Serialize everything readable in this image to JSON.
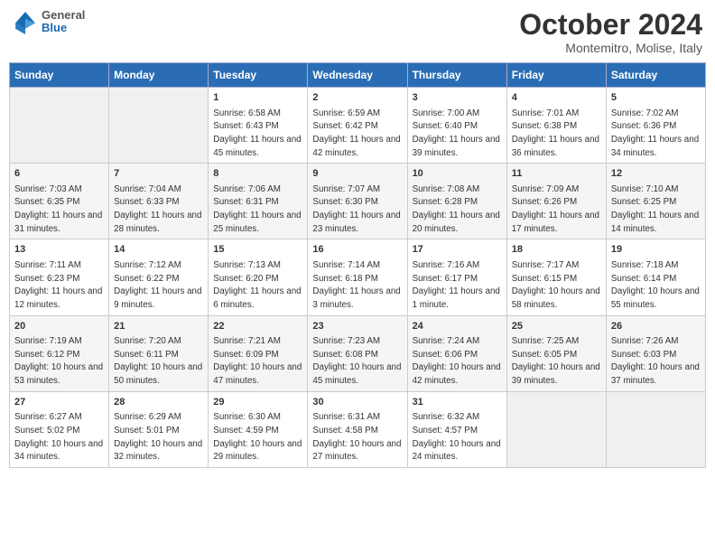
{
  "header": {
    "logo": {
      "line1": "General",
      "line2": "Blue"
    },
    "title": "October 2024",
    "location": "Montemitro, Molise, Italy"
  },
  "weekdays": [
    "Sunday",
    "Monday",
    "Tuesday",
    "Wednesday",
    "Thursday",
    "Friday",
    "Saturday"
  ],
  "weeks": [
    [
      {
        "day": "",
        "sunrise": "",
        "sunset": "",
        "daylight": "",
        "empty": true
      },
      {
        "day": "",
        "sunrise": "",
        "sunset": "",
        "daylight": "",
        "empty": true
      },
      {
        "day": "1",
        "sunrise": "Sunrise: 6:58 AM",
        "sunset": "Sunset: 6:43 PM",
        "daylight": "Daylight: 11 hours and 45 minutes."
      },
      {
        "day": "2",
        "sunrise": "Sunrise: 6:59 AM",
        "sunset": "Sunset: 6:42 PM",
        "daylight": "Daylight: 11 hours and 42 minutes."
      },
      {
        "day": "3",
        "sunrise": "Sunrise: 7:00 AM",
        "sunset": "Sunset: 6:40 PM",
        "daylight": "Daylight: 11 hours and 39 minutes."
      },
      {
        "day": "4",
        "sunrise": "Sunrise: 7:01 AM",
        "sunset": "Sunset: 6:38 PM",
        "daylight": "Daylight: 11 hours and 36 minutes."
      },
      {
        "day": "5",
        "sunrise": "Sunrise: 7:02 AM",
        "sunset": "Sunset: 6:36 PM",
        "daylight": "Daylight: 11 hours and 34 minutes."
      }
    ],
    [
      {
        "day": "6",
        "sunrise": "Sunrise: 7:03 AM",
        "sunset": "Sunset: 6:35 PM",
        "daylight": "Daylight: 11 hours and 31 minutes."
      },
      {
        "day": "7",
        "sunrise": "Sunrise: 7:04 AM",
        "sunset": "Sunset: 6:33 PM",
        "daylight": "Daylight: 11 hours and 28 minutes."
      },
      {
        "day": "8",
        "sunrise": "Sunrise: 7:06 AM",
        "sunset": "Sunset: 6:31 PM",
        "daylight": "Daylight: 11 hours and 25 minutes."
      },
      {
        "day": "9",
        "sunrise": "Sunrise: 7:07 AM",
        "sunset": "Sunset: 6:30 PM",
        "daylight": "Daylight: 11 hours and 23 minutes."
      },
      {
        "day": "10",
        "sunrise": "Sunrise: 7:08 AM",
        "sunset": "Sunset: 6:28 PM",
        "daylight": "Daylight: 11 hours and 20 minutes."
      },
      {
        "day": "11",
        "sunrise": "Sunrise: 7:09 AM",
        "sunset": "Sunset: 6:26 PM",
        "daylight": "Daylight: 11 hours and 17 minutes."
      },
      {
        "day": "12",
        "sunrise": "Sunrise: 7:10 AM",
        "sunset": "Sunset: 6:25 PM",
        "daylight": "Daylight: 11 hours and 14 minutes."
      }
    ],
    [
      {
        "day": "13",
        "sunrise": "Sunrise: 7:11 AM",
        "sunset": "Sunset: 6:23 PM",
        "daylight": "Daylight: 11 hours and 12 minutes."
      },
      {
        "day": "14",
        "sunrise": "Sunrise: 7:12 AM",
        "sunset": "Sunset: 6:22 PM",
        "daylight": "Daylight: 11 hours and 9 minutes."
      },
      {
        "day": "15",
        "sunrise": "Sunrise: 7:13 AM",
        "sunset": "Sunset: 6:20 PM",
        "daylight": "Daylight: 11 hours and 6 minutes."
      },
      {
        "day": "16",
        "sunrise": "Sunrise: 7:14 AM",
        "sunset": "Sunset: 6:18 PM",
        "daylight": "Daylight: 11 hours and 3 minutes."
      },
      {
        "day": "17",
        "sunrise": "Sunrise: 7:16 AM",
        "sunset": "Sunset: 6:17 PM",
        "daylight": "Daylight: 11 hours and 1 minute."
      },
      {
        "day": "18",
        "sunrise": "Sunrise: 7:17 AM",
        "sunset": "Sunset: 6:15 PM",
        "daylight": "Daylight: 10 hours and 58 minutes."
      },
      {
        "day": "19",
        "sunrise": "Sunrise: 7:18 AM",
        "sunset": "Sunset: 6:14 PM",
        "daylight": "Daylight: 10 hours and 55 minutes."
      }
    ],
    [
      {
        "day": "20",
        "sunrise": "Sunrise: 7:19 AM",
        "sunset": "Sunset: 6:12 PM",
        "daylight": "Daylight: 10 hours and 53 minutes."
      },
      {
        "day": "21",
        "sunrise": "Sunrise: 7:20 AM",
        "sunset": "Sunset: 6:11 PM",
        "daylight": "Daylight: 10 hours and 50 minutes."
      },
      {
        "day": "22",
        "sunrise": "Sunrise: 7:21 AM",
        "sunset": "Sunset: 6:09 PM",
        "daylight": "Daylight: 10 hours and 47 minutes."
      },
      {
        "day": "23",
        "sunrise": "Sunrise: 7:23 AM",
        "sunset": "Sunset: 6:08 PM",
        "daylight": "Daylight: 10 hours and 45 minutes."
      },
      {
        "day": "24",
        "sunrise": "Sunrise: 7:24 AM",
        "sunset": "Sunset: 6:06 PM",
        "daylight": "Daylight: 10 hours and 42 minutes."
      },
      {
        "day": "25",
        "sunrise": "Sunrise: 7:25 AM",
        "sunset": "Sunset: 6:05 PM",
        "daylight": "Daylight: 10 hours and 39 minutes."
      },
      {
        "day": "26",
        "sunrise": "Sunrise: 7:26 AM",
        "sunset": "Sunset: 6:03 PM",
        "daylight": "Daylight: 10 hours and 37 minutes."
      }
    ],
    [
      {
        "day": "27",
        "sunrise": "Sunrise: 6:27 AM",
        "sunset": "Sunset: 5:02 PM",
        "daylight": "Daylight: 10 hours and 34 minutes."
      },
      {
        "day": "28",
        "sunrise": "Sunrise: 6:29 AM",
        "sunset": "Sunset: 5:01 PM",
        "daylight": "Daylight: 10 hours and 32 minutes."
      },
      {
        "day": "29",
        "sunrise": "Sunrise: 6:30 AM",
        "sunset": "Sunset: 4:59 PM",
        "daylight": "Daylight: 10 hours and 29 minutes."
      },
      {
        "day": "30",
        "sunrise": "Sunrise: 6:31 AM",
        "sunset": "Sunset: 4:58 PM",
        "daylight": "Daylight: 10 hours and 27 minutes."
      },
      {
        "day": "31",
        "sunrise": "Sunrise: 6:32 AM",
        "sunset": "Sunset: 4:57 PM",
        "daylight": "Daylight: 10 hours and 24 minutes."
      },
      {
        "day": "",
        "sunrise": "",
        "sunset": "",
        "daylight": "",
        "empty": true
      },
      {
        "day": "",
        "sunrise": "",
        "sunset": "",
        "daylight": "",
        "empty": true
      }
    ]
  ]
}
